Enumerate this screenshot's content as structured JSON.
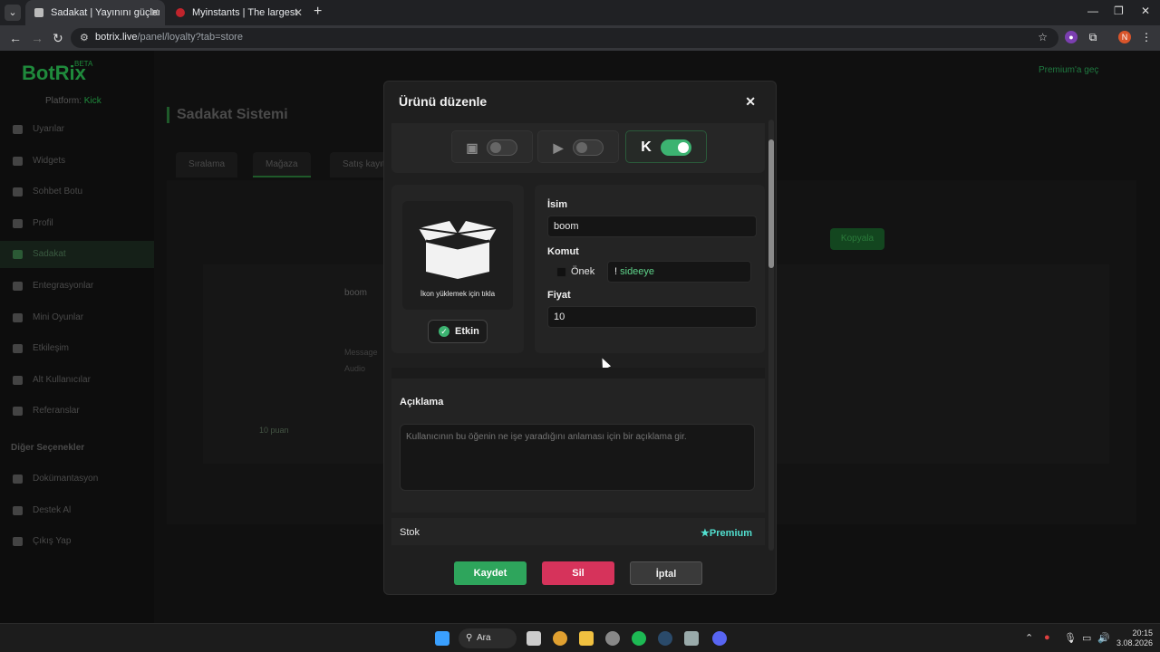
{
  "browser": {
    "tabs": [
      {
        "title": "Sadakat | Yayınını güçlendirmek",
        "active": true
      },
      {
        "title": "Myinstants | The largest instant",
        "active": false
      }
    ],
    "url_host": "botrix.live",
    "url_path": "/panel/loyalty?tab=store",
    "profile_initial": "N"
  },
  "app": {
    "logo": "BotRix",
    "beta": "BETA",
    "platform_label": "Platform:",
    "platform_value": "Kick",
    "sidebar": {
      "items": [
        {
          "label": "Uyarılar"
        },
        {
          "label": "Widgets"
        },
        {
          "label": "Sohbet Botu"
        },
        {
          "label": "Profil"
        },
        {
          "label": "Sadakat"
        },
        {
          "label": "Entegrasyonlar"
        },
        {
          "label": "Mini Oyunlar"
        },
        {
          "label": "Etkileşim"
        },
        {
          "label": "Alt Kullanıcılar"
        },
        {
          "label": "Referanslar"
        }
      ],
      "section": "Diğer Seçenekler",
      "other_items": [
        {
          "label": "Dokümantasyon"
        },
        {
          "label": "Destek Al"
        },
        {
          "label": "Çıkış Yap"
        }
      ]
    },
    "page_title": "Sadakat Sistemi",
    "tabs": [
      "Sıralama",
      "Mağaza",
      "Satış kayıtları"
    ],
    "top_right": "Premium'a geç",
    "bg_button": "Kopyala",
    "card_name": "boom",
    "card_points": "10 puan",
    "card_tags": [
      "Message",
      "Audio"
    ]
  },
  "modal": {
    "title": "Ürünü düzenle",
    "platforms": [
      {
        "name": "twitch-icon",
        "enabled": false
      },
      {
        "name": "youtube-icon",
        "enabled": false
      },
      {
        "name": "kick-icon",
        "enabled": true
      }
    ],
    "upload_caption": "İkon yüklemek için tıkla",
    "enabled_label": "Etkin",
    "name_label": "İsim",
    "name_value": "boom",
    "command_label": "Komut",
    "prefix_label": "Önek",
    "command_prefix": "!",
    "command_value": "sideeye",
    "price_label": "Fiyat",
    "price_value": "10",
    "desc_label": "Açıklama",
    "desc_placeholder": "Kullanıcının bu öğenin ne işe yaradığını anlaması için bir açıklama gir.",
    "stock_label": "Stok",
    "premium_label": "Premium",
    "save": "Kaydet",
    "delete": "Sil",
    "cancel": "İptal"
  },
  "taskbar": {
    "search": "Ara",
    "time": "20:15",
    "date": "3.08.2026"
  },
  "colors": {
    "accent": "#3cb371",
    "danger": "#d6335b",
    "premium": "#52e0d0"
  }
}
